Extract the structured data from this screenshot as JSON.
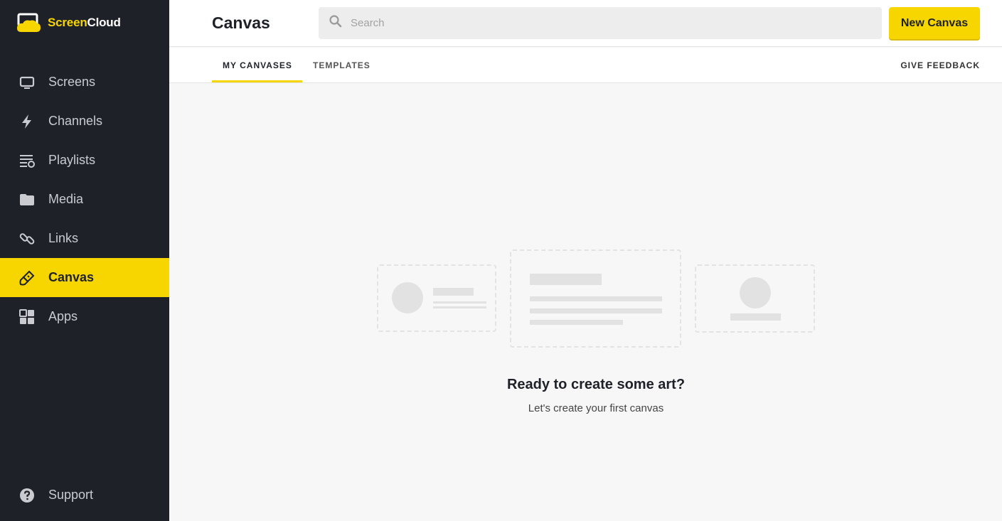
{
  "app": {
    "logo_part1": "Screen",
    "logo_part2": "Cloud",
    "brand_color": "#f7d600",
    "sidebar_color": "#1f2129"
  },
  "sidebar": {
    "items": [
      {
        "label": "Screens",
        "icon": "monitor-icon"
      },
      {
        "label": "Channels",
        "icon": "lightning-icon"
      },
      {
        "label": "Playlists",
        "icon": "playlist-icon"
      },
      {
        "label": "Media",
        "icon": "folder-icon"
      },
      {
        "label": "Links",
        "icon": "link-icon"
      },
      {
        "label": "Canvas",
        "icon": "brush-icon",
        "active": true
      },
      {
        "label": "Apps",
        "icon": "grid-icon"
      }
    ],
    "support": {
      "label": "Support",
      "icon": "help-icon"
    }
  },
  "header": {
    "title": "Canvas",
    "search_placeholder": "Search",
    "new_button": "New Canvas"
  },
  "tabs": {
    "items": [
      "MY CANVASES",
      "TEMPLATES"
    ],
    "active": "MY CANVASES",
    "feedback": "GIVE FEEDBACK"
  },
  "empty_state": {
    "title": "Ready to create some art?",
    "subtitle": "Let's create your first canvas"
  }
}
